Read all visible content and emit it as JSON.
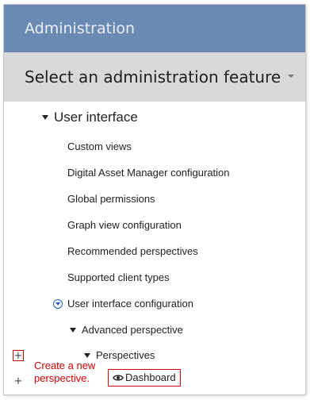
{
  "header": {
    "title": "Administration"
  },
  "selector": {
    "label": "Select an administration feature"
  },
  "tree": {
    "root": {
      "label": "User interface"
    },
    "items": [
      {
        "label": "Custom views"
      },
      {
        "label": "Digital Asset Manager configuration"
      },
      {
        "label": "Global permissions"
      },
      {
        "label": "Graph view configuration"
      },
      {
        "label": "Recommended perspectives"
      },
      {
        "label": "Supported client types"
      }
    ],
    "ui_config": {
      "label": "User interface configuration"
    },
    "advanced": {
      "label": "Advanced perspective"
    },
    "perspectives": {
      "label": "Perspectives"
    },
    "dashboard": {
      "label": "Dashboard"
    }
  },
  "annotation": {
    "line1": "Create a new",
    "line2": "perspective."
  },
  "colors": {
    "header_bg": "#6a89b3",
    "selector_bg": "#d9d9d9",
    "highlight": "#d40000",
    "icon_blue": "#1a63b8"
  },
  "icons": [
    "chevron-down-icon",
    "expand-triangle-icon",
    "collapse-circle-icon",
    "plus-icon",
    "eye-icon"
  ]
}
